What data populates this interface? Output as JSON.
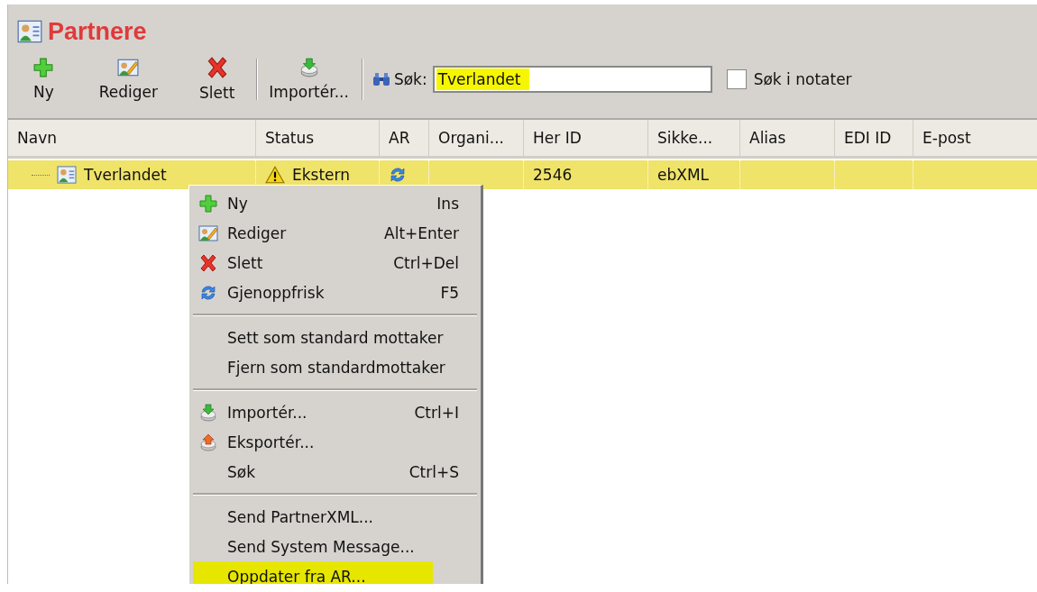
{
  "window": {
    "title": "Partnere"
  },
  "toolbar": [
    {
      "label": "Ny"
    },
    {
      "label": "Rediger"
    },
    {
      "label": "Slett"
    },
    {
      "label": "Importér..."
    }
  ],
  "search": {
    "label": "Søk:",
    "value": "Tverlandet",
    "highlighted": true
  },
  "notes_checkbox": {
    "label": "Søk i notater",
    "checked": false
  },
  "table": {
    "columns": [
      "Navn",
      "Status",
      "AR",
      "Organi...",
      "Her ID",
      "Sikke...",
      "Alias",
      "EDI ID",
      "E-post"
    ],
    "rows": [
      {
        "selected": true,
        "name": "Tverlandet",
        "status": "Ekstern",
        "organization": "",
        "her_id": "2546",
        "security": "ebXML"
      }
    ]
  },
  "context_menu": {
    "groups": [
      [
        {
          "label": "Ny",
          "shortcut": "Ins",
          "highlighted": false
        },
        {
          "label": "Rediger",
          "shortcut": "Alt+Enter",
          "highlighted": false
        },
        {
          "label": "Slett",
          "shortcut": "Ctrl+Del",
          "highlighted": false
        },
        {
          "label": "Gjenoppfrisk",
          "shortcut": "F5",
          "highlighted": false
        }
      ],
      [
        {
          "label": "Sett som standard mottaker",
          "highlighted": false
        },
        {
          "label": "Fjern som standardmottaker",
          "highlighted": false
        }
      ],
      [
        {
          "label": "Importér...",
          "shortcut": "Ctrl+I",
          "highlighted": false
        },
        {
          "label": "Eksportér...",
          "highlighted": false
        },
        {
          "label": "Søk",
          "shortcut": "Ctrl+S",
          "highlighted": false
        }
      ],
      [
        {
          "label": "Send PartnerXML...",
          "highlighted": false
        },
        {
          "label": "Send System Message...",
          "highlighted": false
        },
        {
          "label": "Oppdater fra AR...",
          "highlighted": true
        }
      ]
    ]
  }
}
